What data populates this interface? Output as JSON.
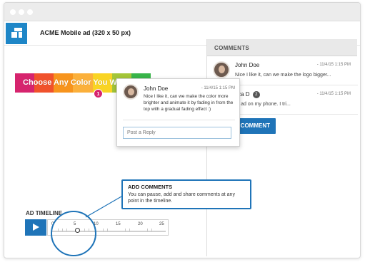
{
  "app": {
    "title": "ACME Mobile ad (320 x 50 px)",
    "accent": "#1f74b8",
    "logo_icon": "brand-logo-icon"
  },
  "banner": {
    "text": "Choose Any Color You W",
    "colors": [
      "#d6246e",
      "#f0522c",
      "#f7941d",
      "#fbb03b",
      "#f9d423",
      "#a4c639",
      "#39b54a"
    ],
    "marker_number": "1"
  },
  "popup": {
    "author": "John Doe",
    "time": "- 11/4/15 1:15 PM",
    "text": "Nice I like it, can we make the color more brighter and animate it by fading in from the top with a gradual fading effect :)",
    "reply_placeholder": "Post a Reply"
  },
  "comments_panel": {
    "header": "COMMENTS",
    "items": [
      {
        "author": "John Doe",
        "time": "- 11/4/15 1:15 PM",
        "text": "Nice I like it, can we make the logo bigger..."
      },
      {
        "author": "Tiffany Case, Liza D",
        "badge": "2",
        "time": "- 11/4/15 1:15 PM",
        "text": "How can I see this ad on my phone. I tri..."
      }
    ],
    "comment_button": "COMMENT"
  },
  "timeline": {
    "label": "AD TIMELINE",
    "ticks": [
      "0",
      "5",
      "10",
      "15",
      "20",
      "25"
    ],
    "current": 5
  },
  "tooltip": {
    "title": "ADD COMMENTS",
    "text": "You can pause, add and share comments at any point in the timeline."
  }
}
